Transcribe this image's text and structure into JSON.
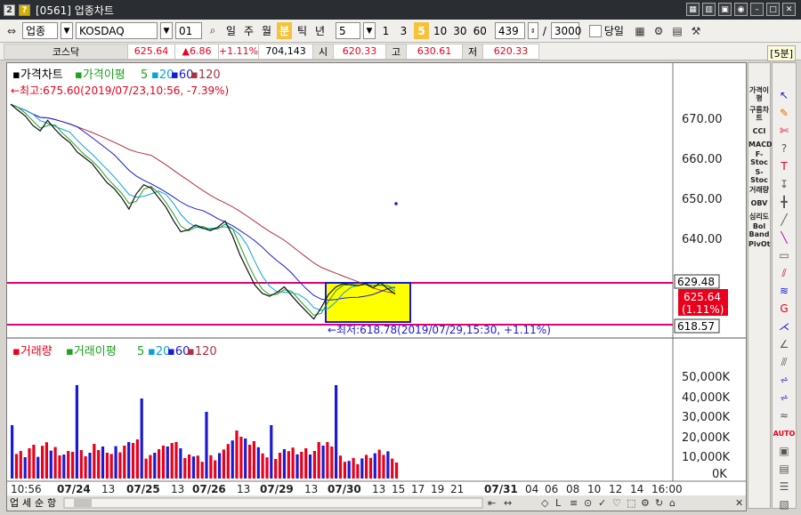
{
  "window": {
    "code_badge": "2",
    "help_badge": "?",
    "title": "[0561] 업종차트",
    "controls": [
      "▦",
      "▥",
      "▣",
      "◉",
      "–",
      "□",
      "✕"
    ]
  },
  "toolbar": {
    "market": "업종",
    "index_name": "KOSDAQ",
    "index_code": "01",
    "periods": [
      "일",
      "주",
      "월",
      "분",
      "틱",
      "년"
    ],
    "active_period": "분",
    "interval": "5",
    "minutes": [
      "1",
      "3",
      "5",
      "10",
      "30",
      "60"
    ],
    "active_minute": "5",
    "count": "439",
    "divider": "/",
    "total": "3000",
    "today_label": "당일"
  },
  "infobar": {
    "name": "코스닥",
    "price": "625.64",
    "change": "▲6.86",
    "change_pct": "+1.11%",
    "volume": "704,143",
    "open_label": "시",
    "open": "620.33",
    "high_label": "고",
    "high": "630.61",
    "low_label": "저",
    "low": "620.33",
    "period_tag": "[5분]"
  },
  "price_panel": {
    "legend_main": "가격차트",
    "legend_ma": "가격이평",
    "ma_periods": [
      "5",
      "20",
      "60",
      "120"
    ],
    "high_note": "←최고:675.60(2019/07/23,10:56, -7.39%)",
    "low_note": "←최저:618.78(2019/07/29,15:30, +1.11%)",
    "y_ticks": [
      "670.00",
      "660.00",
      "650.00",
      "640.00"
    ],
    "line_upper": "629.48",
    "line_lower": "618.57",
    "current_price": "625.64",
    "current_pct": "(1.11%)"
  },
  "volume_panel": {
    "legend_main": "거래량",
    "legend_ma": "거래이평",
    "ma_periods": [
      "5",
      "20",
      "60",
      "120"
    ],
    "y_ticks": [
      "50,000K",
      "40,000K",
      "30,000K",
      "20,000K",
      "10,000K",
      "0K"
    ]
  },
  "x_axis": {
    "labels": [
      "10:56",
      "07/24",
      "13",
      "07/25",
      "13",
      "07/26",
      "13",
      "07/29",
      "13",
      "07/30",
      "13",
      "15",
      "17",
      "19",
      "21",
      "07/31",
      "04",
      "06",
      "08",
      "10",
      "12",
      "14",
      "16:00"
    ]
  },
  "bottom": {
    "tabs": [
      "업",
      "세",
      "순",
      "항"
    ],
    "tools": [
      "⇤",
      "↔",
      "◇",
      "L",
      "≡",
      "⊙",
      "✓",
      "♡",
      "⬚",
      "⚙",
      "↻",
      "⌂",
      "✕"
    ]
  },
  "right_indicators": [
    "가격이평",
    "구름차트",
    "CCI",
    "MACD",
    "F-Stoc",
    "S-Stoc",
    "거래량",
    "OBV",
    "심리도",
    "Bol Band",
    "PivOt"
  ],
  "right_tools": [
    "cursor",
    "eraser",
    "chart-type",
    "help",
    "text",
    "vline",
    "cross",
    "line",
    "paint",
    "rect",
    "fib",
    "fib2",
    "grid",
    "fan",
    "angle",
    "channel",
    "pattern",
    "wave",
    "wave2",
    "wave3",
    "auto",
    "panel",
    "note",
    "menu",
    "save",
    "graph"
  ],
  "colors": {
    "up": "#e8001c",
    "down": "#1a1ad6",
    "ma5": "#20a020",
    "ma20": "#0aa0e0",
    "ma60": "#1a1ad6",
    "ma120": "#b0303c",
    "line": "#e0007a",
    "box": "#ffff00"
  },
  "chart_data": {
    "type": "line",
    "series": [
      {
        "name": "가격",
        "values": [
          675.6,
          674.0,
          672.5,
          670.0,
          668.6,
          671.4,
          669.0,
          667.0,
          665.5,
          663.0,
          661.5,
          660.0,
          657.5,
          655.0,
          653.4,
          651.0,
          648.0,
          652.0,
          654.4,
          653.5,
          651.0,
          648.5,
          645.0,
          642.0,
          642.5,
          643.8,
          643.0,
          642.3,
          643.2,
          644.8,
          641.0,
          636.0,
          632.0,
          628.0,
          625.8,
          625.0,
          626.0,
          627.5,
          625.2,
          623.0,
          621.0,
          619.0,
          622.0,
          625.5,
          627.5,
          628.3,
          628.0,
          627.8,
          628.4,
          627.2,
          628.6,
          627.0,
          625.6
        ]
      }
    ],
    "ylim": [
      618,
      678
    ]
  }
}
